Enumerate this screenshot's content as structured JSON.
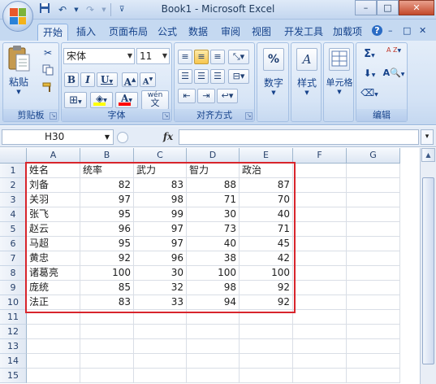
{
  "window": {
    "title": "Book1 - Microsoft Excel",
    "minimize": "–",
    "restore": "□",
    "close": "✕"
  },
  "qat": {
    "save_icon": "save-icon",
    "undo_icon": "undo-icon",
    "redo_icon": "redo-icon",
    "customize_icon": "customize-qat-icon"
  },
  "ribbon_tabs": [
    "开始",
    "插入",
    "页面布局",
    "公式",
    "数据",
    "审阅",
    "视图",
    "开发工具",
    "加载项"
  ],
  "ribbon_right": {
    "help": "?",
    "minimize": "–",
    "restore": "□",
    "close": "✕"
  },
  "clipboard": {
    "label": "剪贴板",
    "paste": "粘贴"
  },
  "font": {
    "label": "字体",
    "name": "宋体",
    "size": "11",
    "bold": "B",
    "italic": "I",
    "underline": "U",
    "grow": "A",
    "shrink": "A",
    "wen": "wén",
    "color_char": "A",
    "fill_color": "#ffff00",
    "font_color": "#ff0000"
  },
  "alignment": {
    "label": "对齐方式"
  },
  "number": {
    "label": "数字",
    "percent": "%"
  },
  "styles": {
    "label": "样式"
  },
  "cells": {
    "label": "单元格"
  },
  "editing": {
    "label": "编辑",
    "sigma": "Σ",
    "sort": "A Z",
    "find": "A"
  },
  "formula_bar": {
    "name_box": "H30",
    "fx": "fx",
    "formula": ""
  },
  "columns": [
    "A",
    "B",
    "C",
    "D",
    "E",
    "F",
    "G"
  ],
  "rows": [
    "1",
    "2",
    "3",
    "4",
    "5",
    "6",
    "7",
    "8",
    "9",
    "10",
    "11",
    "12",
    "13",
    "14",
    "15"
  ],
  "table": {
    "headers": [
      "姓名",
      "统率",
      "武力",
      "智力",
      "政治"
    ],
    "data": [
      [
        "刘备",
        "82",
        "83",
        "88",
        "87"
      ],
      [
        "关羽",
        "97",
        "98",
        "71",
        "70"
      ],
      [
        "张飞",
        "95",
        "99",
        "30",
        "40"
      ],
      [
        "赵云",
        "96",
        "97",
        "73",
        "71"
      ],
      [
        "马超",
        "95",
        "97",
        "40",
        "45"
      ],
      [
        "黄忠",
        "92",
        "96",
        "38",
        "42"
      ],
      [
        "诸葛亮",
        "100",
        "30",
        "100",
        "100"
      ],
      [
        "庞统",
        "85",
        "32",
        "98",
        "92"
      ],
      [
        "法正",
        "83",
        "33",
        "94",
        "92"
      ]
    ]
  },
  "highlight_color": "#d8252c"
}
